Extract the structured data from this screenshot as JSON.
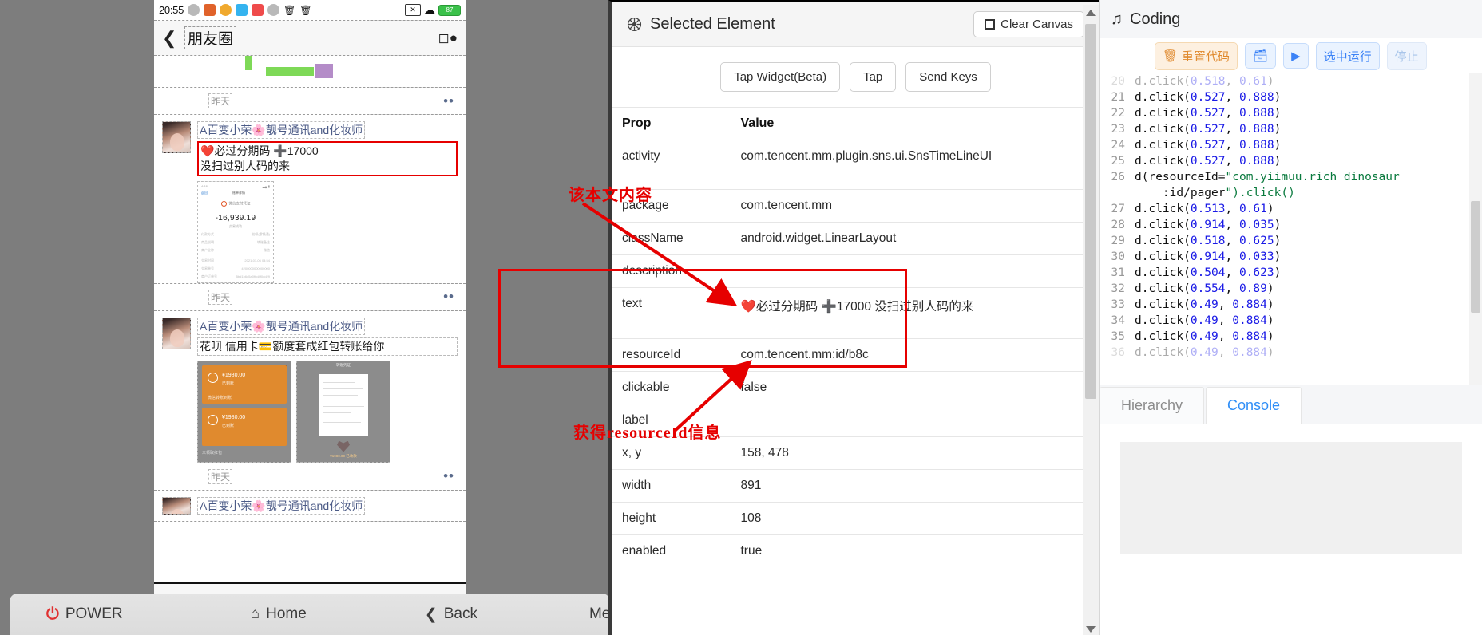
{
  "device": {
    "status_bar": {
      "clock": "20:55",
      "battery": "87",
      "wifi_icon": "wifi-icon"
    },
    "wechat_header": {
      "back_icon": "chevron-left-icon",
      "title": "朋友圈",
      "camera_icon": "camera-icon"
    },
    "feed": [
      {
        "time_label": "昨天",
        "more_icon": "more-dots-icon",
        "poster": "A百变小荣🌸靓号通讯and化妆师",
        "text_line1": "❤️必过分期码 ➕17000",
        "text_line2": "没扫过别人码的来",
        "highlighted": true,
        "receipt": {
          "nav_back": "返回",
          "nav_title": "账单详情",
          "amount": "-16,939.19",
          "sub": "交易成功",
          "rows": [
            [
              "付款方式",
              "花呗(零钱通)"
            ],
            [
              "商品说明",
              "转账备注"
            ],
            [
              "商户全称",
              "微信"
            ],
            [
              "交易时间",
              "2021-01-06 04:54"
            ],
            [
              "交易单号",
              "420000000000000000"
            ],
            [
              "商户订单号",
              "5bd1b6d5a0f6d4f0dd29"
            ]
          ],
          "footer_rows": [
            [
              "账单分类",
              "其他"
            ],
            [
              "账单备注",
              "添加"
            ],
            [
              "查看账单记录",
              ""
            ],
            [
              "对此交易有疑问",
              ""
            ]
          ]
        }
      },
      {
        "time_label": "昨天",
        "more_icon": "more-dots-icon",
        "poster": "A百变小荣🌸靓号通讯and化妆师",
        "text_line1": "花呗 信用卡💳额度套成红包转账给你",
        "highlighted": false,
        "pay_card": {
          "rows": [
            {
              "amount": "¥1980.00",
              "status": "已到账",
              "footer": "微信转账到账"
            },
            {
              "amount": "¥1980.00",
              "status": "已到账",
              "footer": ""
            }
          ],
          "badge": "未领取红包"
        },
        "doc_card": {
          "caption": "转账凭证",
          "label": "¥1980.00 已收款"
        }
      },
      {
        "poster": "A百变小荣🌸靓号通讯and化妆师"
      }
    ],
    "navbar": {
      "recents_icon": "square-icon",
      "home_icon": "circle-icon",
      "back_icon": "triangle-back-icon"
    }
  },
  "hw_toolbar": {
    "power": {
      "label": "POWER",
      "icon": "power-icon"
    },
    "home": {
      "label": "Home",
      "icon": "home-icon"
    },
    "back": {
      "label": "Back",
      "icon": "chevron-left-icon"
    },
    "menu": {
      "label": "Menu"
    }
  },
  "inspector": {
    "title": "Selected Element",
    "title_icon": "target-gear-icon",
    "clear_button": "Clear Canvas",
    "clear_checkbox_icon": "checkbox-icon",
    "actions": [
      "Tap Widget(Beta)",
      "Tap",
      "Send Keys"
    ],
    "table": {
      "headers": [
        "Prop",
        "Value"
      ],
      "rows": [
        {
          "prop": "activity",
          "value": "com.tencent.mm.plugin.sns.ui.SnsTimeLineUI"
        },
        {
          "prop": "package",
          "value": "com.tencent.mm"
        },
        {
          "prop": "className",
          "value": "android.widget.LinearLayout"
        },
        {
          "prop": "description",
          "value": ""
        },
        {
          "prop": "text",
          "value": "❤️必过分期码 ➕17000 没扫过别人码的来"
        },
        {
          "prop": "resourceId",
          "value": "com.tencent.mm:id/b8c"
        },
        {
          "prop": "clickable",
          "value": "false"
        },
        {
          "prop": "label",
          "value": ""
        },
        {
          "prop": "x, y",
          "value": "158, 478"
        },
        {
          "prop": "width",
          "value": "891"
        },
        {
          "prop": "height",
          "value": "108"
        },
        {
          "prop": "enabled",
          "value": "true"
        }
      ]
    }
  },
  "annotations": {
    "note_text_content": "该本文内容",
    "note_resource_id": "获得resourceId信息"
  },
  "coding": {
    "title": "Coding",
    "title_icon": "music-note-icon",
    "toolbar": {
      "reset": {
        "label": "重置代码",
        "icon": "trash-icon"
      },
      "copy": {
        "label": "",
        "icon": "copy-icon"
      },
      "run": {
        "label": "",
        "icon": "play-icon"
      },
      "run_selection": {
        "label": "选中运行"
      },
      "stop": {
        "label": "停止"
      }
    },
    "editor_lines": [
      {
        "no": "20",
        "text": "d.click(0.518, 0.61)"
      },
      {
        "no": "21",
        "text": "d.click(0.527, 0.888)"
      },
      {
        "no": "22",
        "text": "d.click(0.527, 0.888)"
      },
      {
        "no": "23",
        "text": "d.click(0.527, 0.888)"
      },
      {
        "no": "24",
        "text": "d.click(0.527, 0.888)"
      },
      {
        "no": "25",
        "text": "d.click(0.527, 0.888)"
      },
      {
        "no": "26",
        "text": "d(resourceId=\"com.yiimuu.rich_dinosaur"
      },
      {
        "no": "",
        "text": "    :id/pager\").click()"
      },
      {
        "no": "27",
        "text": "d.click(0.513, 0.61)"
      },
      {
        "no": "28",
        "text": "d.click(0.914, 0.035)"
      },
      {
        "no": "29",
        "text": "d.click(0.518, 0.625)"
      },
      {
        "no": "30",
        "text": "d.click(0.914, 0.033)"
      },
      {
        "no": "31",
        "text": "d.click(0.504, 0.623)"
      },
      {
        "no": "32",
        "text": "d.click(0.554, 0.89)"
      },
      {
        "no": "33",
        "text": "d.click(0.49, 0.884)"
      },
      {
        "no": "34",
        "text": "d.click(0.49, 0.884)"
      },
      {
        "no": "35",
        "text": "d.click(0.49, 0.884)"
      },
      {
        "no": "36",
        "text": "d.click(0.49, 0.884)"
      }
    ],
    "tabs": [
      {
        "label": "Hierarchy",
        "active": false
      },
      {
        "label": "Console",
        "active": true
      }
    ]
  },
  "colors": {
    "accent_blue": "#2f8ef7",
    "annotation_red": "#e60000",
    "orange": "#e08a2e",
    "panel_gray": "#7d7d7d"
  }
}
